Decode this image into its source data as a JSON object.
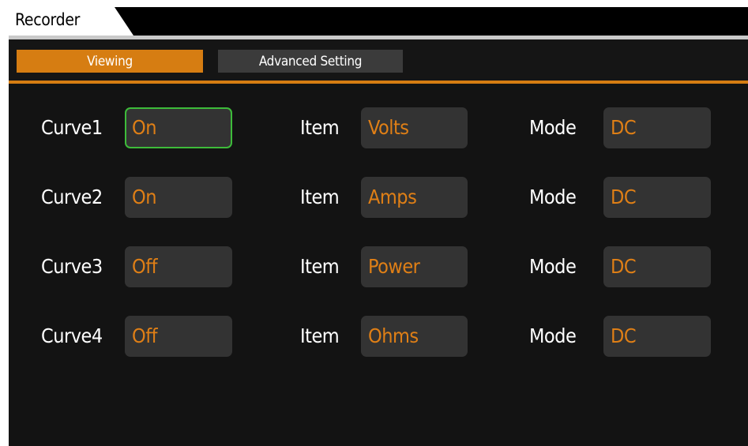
{
  "window": {
    "title": "Recorder"
  },
  "tabs": [
    {
      "label": "Viewing",
      "active": true
    },
    {
      "label": "Advanced Setting",
      "active": false
    }
  ],
  "labels": {
    "item": "Item",
    "mode": "Mode"
  },
  "curves": [
    {
      "name": "Curve1",
      "state": "On",
      "item": "Volts",
      "mode": "DC",
      "focused": true
    },
    {
      "name": "Curve2",
      "state": "On",
      "item": "Amps",
      "mode": "DC",
      "focused": false
    },
    {
      "name": "Curve3",
      "state": "Off",
      "item": "Power",
      "mode": "DC",
      "focused": false
    },
    {
      "name": "Curve4",
      "state": "Off",
      "item": "Ohms",
      "mode": "DC",
      "focused": false
    }
  ],
  "colors": {
    "accent": "#d67d12",
    "value_text": "#df7f16",
    "focus_border": "#3dbb3a",
    "field_bg": "#333333",
    "background": "#131313"
  }
}
